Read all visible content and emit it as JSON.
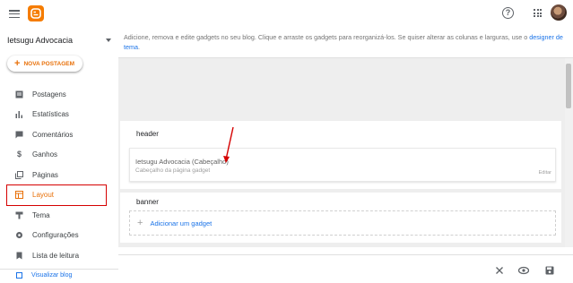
{
  "app": {
    "menu_icon": "menu-icon",
    "logo_icon": "blogger-logo",
    "help_icon": "help-circle-icon",
    "apps_icon": "apps-grid-icon",
    "accent_color": "#e8710a",
    "link_color": "#1a73e8",
    "highlight_color": "#d50000"
  },
  "sidebar": {
    "blog_name": "Ietsugu Advocacia",
    "new_post_label": "NOVA POSTAGEM",
    "items": [
      {
        "label": "Postagens",
        "icon": "posts-icon"
      },
      {
        "label": "Estatísticas",
        "icon": "stats-icon"
      },
      {
        "label": "Comentários",
        "icon": "comments-icon"
      },
      {
        "label": "Ganhos",
        "icon": "earnings-icon"
      },
      {
        "label": "Páginas",
        "icon": "pages-icon"
      },
      {
        "label": "Layout",
        "icon": "layout-icon",
        "active": true
      },
      {
        "label": "Tema",
        "icon": "theme-icon"
      },
      {
        "label": "Configurações",
        "icon": "settings-icon"
      },
      {
        "label": "Lista de leitura",
        "icon": "reading-list-icon"
      }
    ],
    "view_blog_label": "Visualizar blog"
  },
  "main": {
    "info_text": "Adicione, remova e edite gadgets no seu blog. Clique e arraste os gadgets para reorganizá-los. Se quiser alterar as colunas e larguras, use o",
    "info_link": "designer de tema",
    "info_end": ".",
    "sections": {
      "header": {
        "title": "header",
        "gadget_title": "Ietsugu Advocacia (Cabeçalho)",
        "gadget_sub": "Cabeçalho da página gadget",
        "edit_label": "Editar"
      },
      "banner": {
        "title": "banner",
        "add_label": "Adicionar um gadget"
      }
    }
  },
  "bottombar": {
    "close_icon": "close-icon",
    "preview_icon": "eye-icon",
    "save_icon": "save-icon"
  }
}
